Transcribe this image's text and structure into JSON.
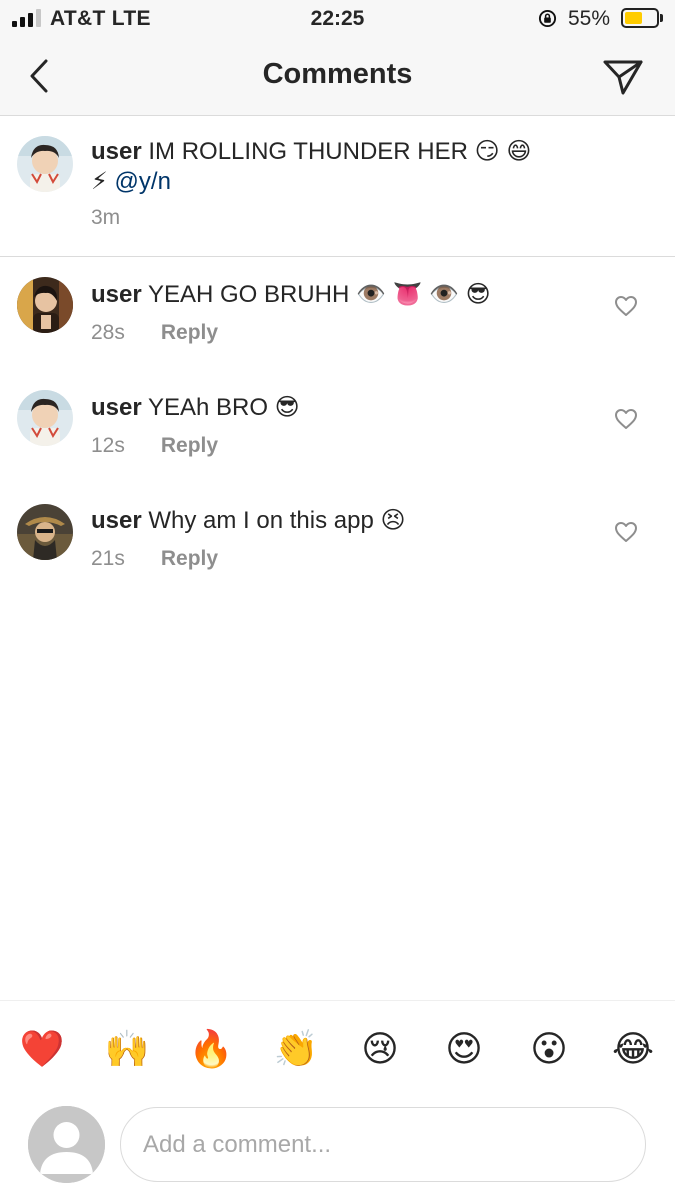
{
  "status_bar": {
    "carrier": "AT&T   LTE",
    "time": "22:25",
    "battery": "55%",
    "battery_level": 0.55
  },
  "header": {
    "title": "Comments",
    "back_icon": "chevron-left-icon",
    "send_icon": "paper-plane-icon"
  },
  "caption": {
    "username": "user",
    "text_line1": " IM ROLLING THUNDER HER 😏 😄",
    "text_line2_prefix": "⚡ ",
    "mention": "@y/n",
    "time": "3m"
  },
  "comments": [
    {
      "username": "user",
      "text": " YEAH GO BRUHH 👁️ 👅 👁️ 😎",
      "time": "28s",
      "reply": "Reply"
    },
    {
      "username": "user",
      "text": " YEAh BRO 😎",
      "time": "12s",
      "reply": "Reply"
    },
    {
      "username": "user",
      "text": " Why am I on this app 😣",
      "time": "21s",
      "reply": "Reply"
    }
  ],
  "emoji_bar": [
    "❤️",
    "🙌",
    "🔥",
    "👏",
    "😢",
    "😍",
    "😮",
    "😂"
  ],
  "composer": {
    "placeholder": "Add a comment..."
  }
}
